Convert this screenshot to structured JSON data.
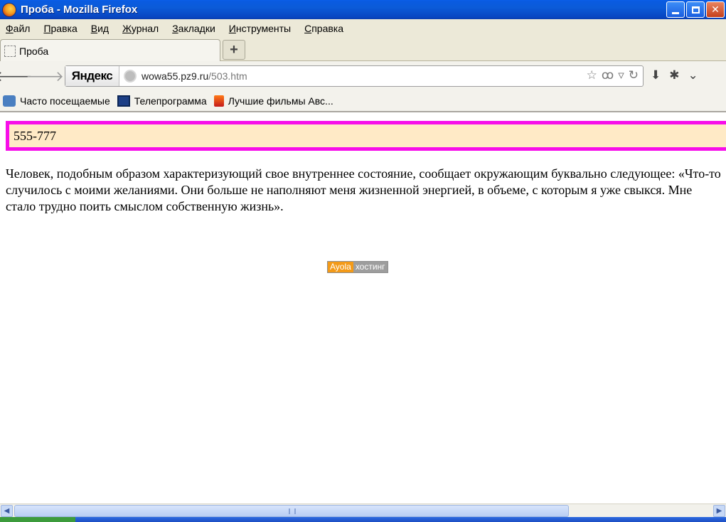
{
  "window": {
    "title": "Проба - Mozilla Firefox"
  },
  "menu": {
    "items": [
      {
        "u": "Ф",
        "rest": "айл"
      },
      {
        "u": "П",
        "rest": "равка"
      },
      {
        "u": "В",
        "rest": "ид"
      },
      {
        "u": "Ж",
        "rest": "урнал"
      },
      {
        "u": "З",
        "rest": "акладки"
      },
      {
        "u": "И",
        "rest": "нструменты"
      },
      {
        "u": "С",
        "rest": "правка"
      }
    ]
  },
  "tab": {
    "label": "Проба",
    "new_tab_glyph": "+"
  },
  "nav": {
    "search_engine": "Яндекс",
    "url_host": "wowa55.pz9.ru",
    "url_path": "/503.htm"
  },
  "bookmarks": [
    {
      "label": "Часто посещаемые",
      "icon": "search-folder-icon"
    },
    {
      "label": "Телепрограмма",
      "icon": "tv-icon"
    },
    {
      "label": "Лучшие фильмы Авс...",
      "icon": "film-icon"
    }
  ],
  "page": {
    "box_text": "555-777",
    "paragraph": "Человек, подобным образом характеризующий свое внутреннее состояние, сообщает окружающим буквально следующее: «Что-то случилось с моими желаниями. Они больше не наполняют меня жизненной энергией, в объеме, с которым я уже свыкся. Мне стало трудно поить смыслом собственную жизнь».",
    "badge_left": "Ayola",
    "badge_right": "хостинг"
  },
  "colors": {
    "box_border": "#f70ee9",
    "box_fill": "#ffeac6",
    "badge_orange": "#f39a18"
  }
}
